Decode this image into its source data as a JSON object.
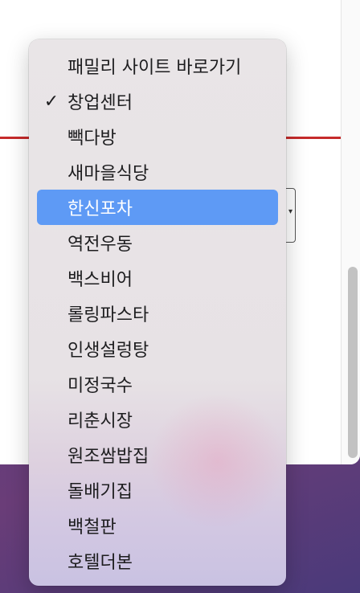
{
  "dropdown": {
    "items": [
      {
        "label": "패밀리 사이트 바로가기",
        "checked": false,
        "highlighted": false
      },
      {
        "label": "창업센터",
        "checked": true,
        "highlighted": false
      },
      {
        "label": "빽다방",
        "checked": false,
        "highlighted": false
      },
      {
        "label": "새마을식당",
        "checked": false,
        "highlighted": false
      },
      {
        "label": "한신포차",
        "checked": false,
        "highlighted": true
      },
      {
        "label": "역전우동",
        "checked": false,
        "highlighted": false
      },
      {
        "label": "백스비어",
        "checked": false,
        "highlighted": false
      },
      {
        "label": "롤링파스타",
        "checked": false,
        "highlighted": false
      },
      {
        "label": "인생설렁탕",
        "checked": false,
        "highlighted": false
      },
      {
        "label": "미정국수",
        "checked": false,
        "highlighted": false
      },
      {
        "label": "리춘시장",
        "checked": false,
        "highlighted": false
      },
      {
        "label": "원조쌈밥집",
        "checked": false,
        "highlighted": false
      },
      {
        "label": "돌배기집",
        "checked": false,
        "highlighted": false
      },
      {
        "label": "백철판",
        "checked": false,
        "highlighted": false
      },
      {
        "label": "호텔더본",
        "checked": false,
        "highlighted": false
      }
    ],
    "check_glyph": "✓",
    "check_icon": "checkmark-icon"
  },
  "colors": {
    "highlight": "#5e9af5",
    "rule": "#c62b2b",
    "menu_bg": "#e9e5e7"
  },
  "select": {
    "arrow_icon": "chevron-updown-icon"
  }
}
